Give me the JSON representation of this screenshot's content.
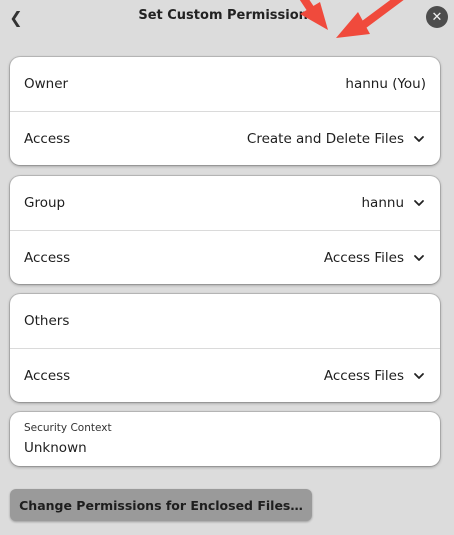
{
  "header": {
    "back_icon": "chevron-left-icon",
    "title": "Set Custom Permissions",
    "close_icon": "close-icon"
  },
  "owner": {
    "label": "Owner",
    "value": "hannu (You)",
    "access_label": "Access",
    "access_value": "Create and Delete Files"
  },
  "group": {
    "label": "Group",
    "value": "hannu",
    "access_label": "Access",
    "access_value": "Access Files"
  },
  "others": {
    "label": "Others",
    "access_label": "Access",
    "access_value": "Access Files"
  },
  "security": {
    "label": "Security Context",
    "value": "Unknown"
  },
  "footer": {
    "change_button": "Change Permissions for Enclosed Files…"
  },
  "annotation": {
    "arrow_color": "#f04a3c"
  },
  "colors": {
    "background": "#dcdcdc",
    "card": "#ffffff",
    "button": "#9a9a9a",
    "close_button": "#4d4d4d"
  }
}
